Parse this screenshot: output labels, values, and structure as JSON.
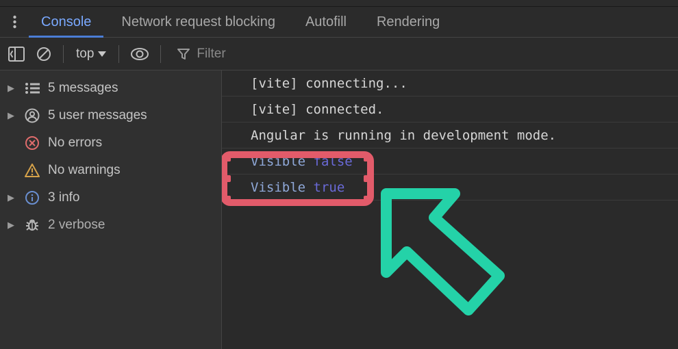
{
  "tabs": {
    "console": "Console",
    "network_blocking": "Network request blocking",
    "autofill": "Autofill",
    "rendering": "Rendering"
  },
  "toolbar": {
    "context_label": "top",
    "filter_placeholder": "Filter"
  },
  "sidebar": {
    "messages": "5 messages",
    "user_messages": "5 user messages",
    "errors": "No errors",
    "warnings": "No warnings",
    "info": "3 info",
    "verbose": "2 verbose"
  },
  "logs": {
    "row0": "[vite] connecting...",
    "row1": "[vite] connected.",
    "row2": "Angular is running in development mode.",
    "row3a": "Visible ",
    "row3b": "false",
    "row4a": "Visible ",
    "row4b": "true"
  }
}
